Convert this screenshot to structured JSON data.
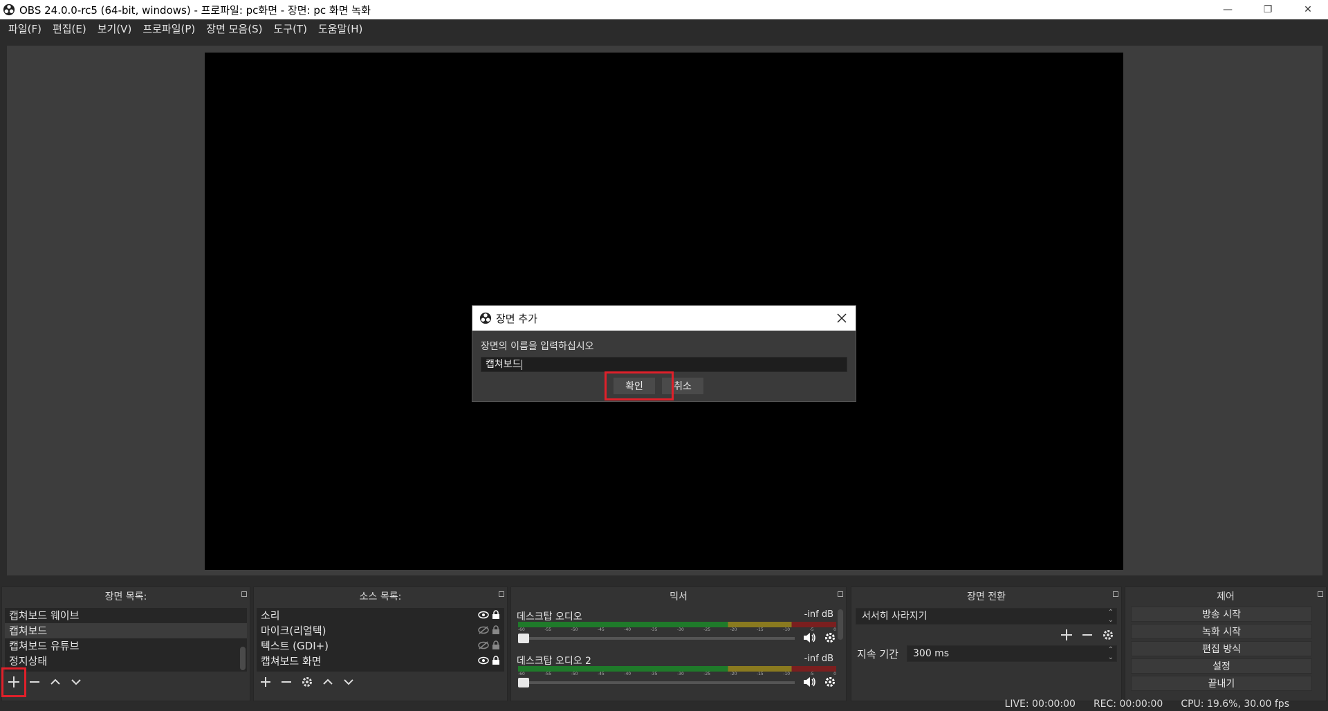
{
  "window": {
    "title": "OBS 24.0.0-rc5 (64-bit, windows) - 프로파일: pc화면 - 장면: pc 화면 녹화",
    "minimize": "—",
    "restore": "❐",
    "close": "✕"
  },
  "menu": [
    "파일(F)",
    "편집(E)",
    "보기(V)",
    "프로파일(P)",
    "장면 모음(S)",
    "도구(T)",
    "도움말(H)"
  ],
  "dialog": {
    "title": "장면 추가",
    "prompt": "장면의 이름을 입력하십시오",
    "input_value": "캡쳐보드",
    "ok_label": "확인",
    "cancel_label": "취소"
  },
  "scenes": {
    "header": "장면 목록:",
    "items": [
      "캡쳐보드 웨이브",
      "캡쳐보드",
      "캡쳐보드 유튜브",
      "정지상태"
    ]
  },
  "sources": {
    "header": "소스 목록:",
    "items": [
      "소리",
      "마이크(리얼텍)",
      "텍스트 (GDI+)",
      "캡쳐보드 화면"
    ]
  },
  "mixer": {
    "header": "믹서",
    "tracks": [
      {
        "name": "데스크탑 오디오",
        "db": "-inf dB"
      },
      {
        "name": "데스크탑 오디오 2",
        "db": "-inf dB"
      }
    ],
    "ticks": [
      "-60",
      "-55",
      "-50",
      "-45",
      "-40",
      "-35",
      "-30",
      "-25",
      "-20",
      "-15",
      "-10",
      "-5",
      "0"
    ]
  },
  "transitions": {
    "header": "장면 전환",
    "selected": "서서히 사라지기",
    "duration_label": "지속 기간",
    "duration_value": "300 ms"
  },
  "controls": {
    "header": "제어",
    "buttons": [
      "방송 시작",
      "녹화 시작",
      "편집 방식",
      "설정",
      "끝내기"
    ]
  },
  "status": {
    "live": "LIVE: 00:00:00",
    "rec": "REC: 00:00:00",
    "cpu": "CPU: 19.6%, 30.00 fps"
  },
  "colors": {
    "highlight": "#e0202a"
  }
}
